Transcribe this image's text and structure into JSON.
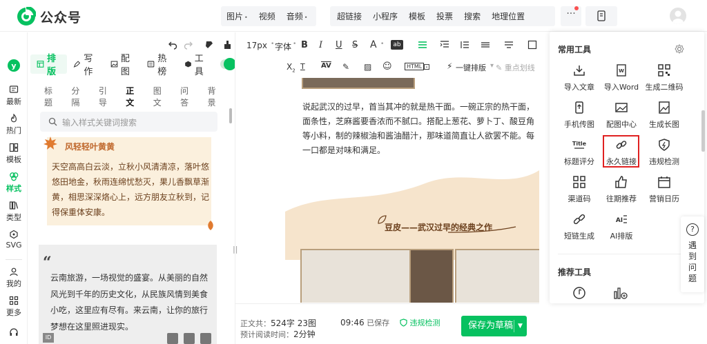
{
  "app": {
    "title": "公众号"
  },
  "topmenu": {
    "group1": [
      {
        "label": "图片",
        "dd": true
      },
      {
        "label": "视频",
        "dd": false
      },
      {
        "label": "音频",
        "dd": true
      }
    ],
    "group2": [
      "超链接",
      "小程序",
      "模板",
      "投票",
      "搜索",
      "地理位置"
    ],
    "more": "···"
  },
  "leftnav": [
    {
      "label": "最新",
      "icon": "message-icon"
    },
    {
      "label": "热门",
      "icon": "fire-icon"
    },
    {
      "label": "模板",
      "icon": "template-icon"
    },
    {
      "label": "样式",
      "icon": "style-icon",
      "active": true
    },
    {
      "label": "类型",
      "icon": "books-icon"
    },
    {
      "label": "SVG",
      "icon": "svg-icon"
    },
    {
      "label": "我的",
      "icon": "user-icon"
    },
    {
      "label": "更多",
      "icon": "grid-icon"
    }
  ],
  "panel": {
    "tabs": [
      "排版",
      "写作",
      "配图",
      "热榜",
      "工具"
    ],
    "subtabs": [
      "标题",
      "分隔",
      "引导",
      "正文",
      "图文",
      "问答",
      "背景"
    ],
    "active_subtab": "正文",
    "search_placeholder": "输入样式关键词搜索",
    "card1": {
      "title": "风轻轻叶黄黄",
      "text": "天空高高白云淡，立秋小风清清凉，落叶悠悠田地金，秋雨连绵忧愁灭，果儿香飘草渐黄，相思深深烙心上，远方朋友立秋到，记得保重体安康。"
    },
    "card2": {
      "quote": "“",
      "text": "云南旅游，一场视觉的盛宴。从美丽的自然风光到千年的历史文化，从民族风情到美食小吃，这里应有尽有。来云南，让你的旅行梦想在这里照进现实。"
    }
  },
  "toolbar": {
    "font_size": "17px",
    "font": "字体",
    "one_click": "一键排版",
    "highlight": "重点划线"
  },
  "editor": {
    "article": "说起武汉的过早，首当其冲的就是热干面。一碗正宗的热干面，面条性，芝麻酱要香浓而不腻口。搭配上葱花、萝卜丁、酸豆角等小料，制的辣椒油和酱油醋汁，那味道简直让人欲罢不能。每一口都是对味和满足。",
    "subtitle": "豆皮——武汉过早的经典之作"
  },
  "bottombar": {
    "body_label": "正文共：",
    "counts": "524字 23图",
    "read_label": "预计阅读时间：",
    "read_time": "2分钟",
    "time": "09:46",
    "saved": "已保存",
    "check": "违规检测",
    "save": "保存为草稿"
  },
  "tools": {
    "common_title": "常用工具",
    "recommended_title": "推荐工具",
    "items": [
      {
        "label": "导入文章",
        "icon": "import-icon"
      },
      {
        "label": "导入Word",
        "icon": "word-icon"
      },
      {
        "label": "生成二维码",
        "icon": "qrcode-icon"
      },
      {
        "label": "手机传图",
        "icon": "phone-upload-icon"
      },
      {
        "label": "配图中心",
        "icon": "image-icon"
      },
      {
        "label": "生成长图",
        "icon": "long-image-icon"
      },
      {
        "label": "标题评分",
        "icon": "title-score-icon"
      },
      {
        "label": "永久链接",
        "icon": "link-icon"
      },
      {
        "label": "违规检测",
        "icon": "shield-icon"
      },
      {
        "label": "渠道码",
        "icon": "channel-code-icon"
      },
      {
        "label": "往期推荐",
        "icon": "thumbs-up-icon"
      },
      {
        "label": "营销日历",
        "icon": "calendar-icon"
      },
      {
        "label": "短链生成",
        "icon": "short-link-icon"
      },
      {
        "label": "AI排版",
        "icon": "ai-layout-icon"
      }
    ]
  },
  "help": {
    "label": "遇到问题",
    "icon_text": "?"
  },
  "colors": {
    "brand": "#07c160",
    "highlight": "#e02020",
    "card_bg": "#fbf0dd"
  }
}
